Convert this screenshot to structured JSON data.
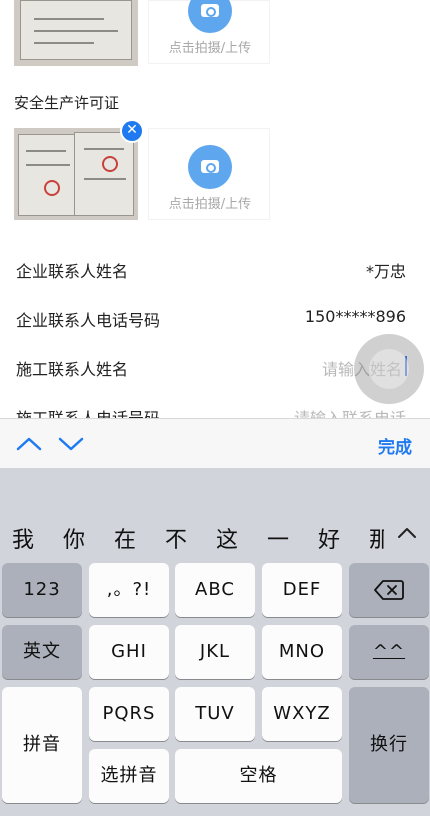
{
  "upload_prompt": "点击拍摄/上传",
  "section_safety_license": "安全生产许可证",
  "fields": [
    {
      "label": "企业联系人姓名",
      "value": "*万忠"
    },
    {
      "label": "企业联系人电话号码",
      "value": "150*****896"
    },
    {
      "label": "施工联系人姓名",
      "placeholder": "请输入姓名"
    },
    {
      "label": "施工联系人电话号码",
      "placeholder": "请输入联系电话"
    }
  ],
  "toolbar": {
    "done_label": "完成"
  },
  "keyboard": {
    "candidates": [
      "我",
      "你",
      "在",
      "不",
      "这",
      "一",
      "好",
      "那"
    ],
    "row1": [
      "123",
      ",。?!",
      "ABC",
      "DEF"
    ],
    "row2": [
      "英文",
      "GHI",
      "JKL",
      "MNO",
      "^^"
    ],
    "row3": [
      "PQRS",
      "TUV",
      "WXYZ"
    ],
    "pinyin_label": "拼音",
    "select_pinyin_label": "选拼音",
    "space_label": "空格",
    "return_label": "换行"
  },
  "colors": {
    "accent": "#1f7af2",
    "camera_circle": "#5ea7ee",
    "keyboard_bg": "#d1d4da"
  }
}
